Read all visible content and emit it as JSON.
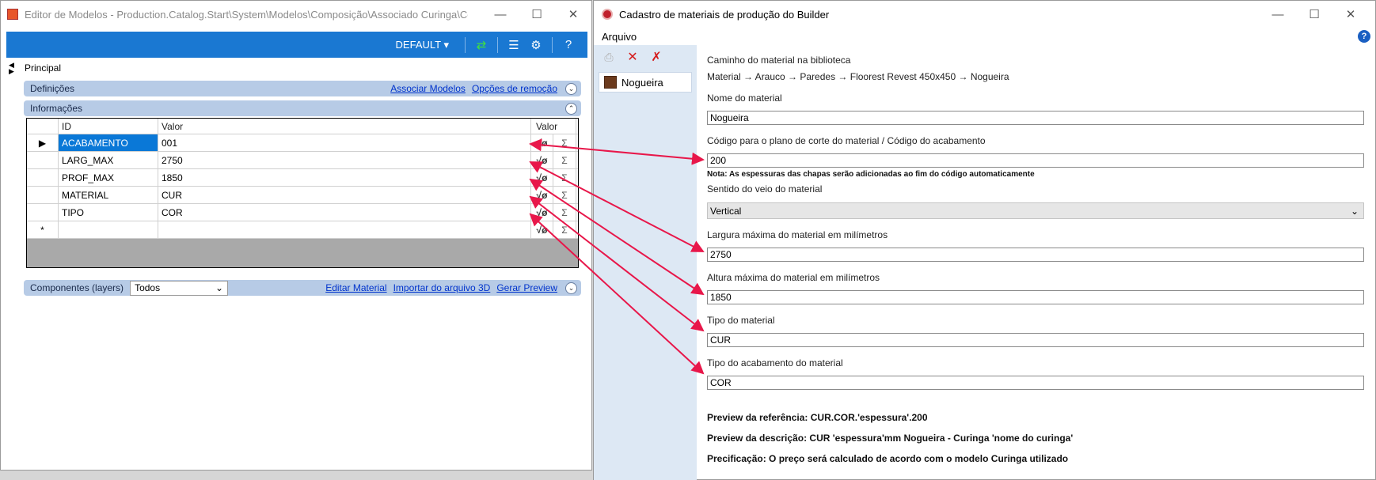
{
  "left_window": {
    "title": "Editor de Modelos - Production.Catalog.Start\\System\\Modelos\\Composição\\Associado Curinga\\Cor",
    "toolbar": {
      "profile": "DEFAULT"
    },
    "principal_label": "Principal",
    "definicoes": {
      "label": "Definições",
      "link_associar": "Associar Modelos",
      "link_opcoes": "Opções de remoção"
    },
    "informacoes": {
      "label": "Informações",
      "headers": {
        "id": "ID",
        "valor": "Valor",
        "valor2": "Valor"
      },
      "rows": [
        {
          "id": "ACABAMENTO",
          "valor": "001"
        },
        {
          "id": "LARG_MAX",
          "valor": "2750"
        },
        {
          "id": "PROF_MAX",
          "valor": "1850"
        },
        {
          "id": "MATERIAL",
          "valor": "CUR"
        },
        {
          "id": "TIPO",
          "valor": "COR"
        }
      ],
      "new_row_marker": "*"
    },
    "componentes": {
      "label": "Componentes (layers)",
      "select_value": "Todos",
      "link_editar": "Editar Material",
      "link_importar": "Importar do arquivo 3D",
      "link_gerar": "Gerar Preview"
    }
  },
  "right_window": {
    "title": "Cadastro de materiais de produção do Builder",
    "menu": {
      "arquivo": "Arquivo"
    },
    "side_item": "Nogueira",
    "form": {
      "caminho_label": "Caminho do material na biblioteca",
      "caminho_value": "Material → Arauco → Paredes → Floorest Revest 450x450 → Nogueira",
      "nome_label": "Nome do material",
      "nome_value": "Nogueira",
      "codigo_label": "Código para o plano de corte do material / Código do acabamento",
      "codigo_value": "200",
      "codigo_note": "Nota: As espessuras das chapas serão adicionadas ao fim do código automaticamente",
      "sentido_label": "Sentido do veio do material",
      "sentido_value": "Vertical",
      "largura_label": "Largura máxima do material em milímetros",
      "largura_value": "2750",
      "altura_label": "Altura máxima do material em milímetros",
      "altura_value": "1850",
      "tipo_label": "Tipo do material",
      "tipo_value": "CUR",
      "acab_label": "Tipo do acabamento do material",
      "acab_value": "COR",
      "preview_ref": "Preview da referência: CUR.COR.'espessura'.200",
      "preview_desc": "Preview da descrição: CUR 'espessura'mm Nogueira - Curinga 'nome do curinga'",
      "precificacao": "Precificação: O preço será calculado de acordo com o modelo Curinga utilizado"
    }
  },
  "colors": {
    "accent_blue": "#1a78d2",
    "arrow_red": "#e8174a",
    "section_bar": "#b7cbe6",
    "selected_cell": "#0a78d7"
  }
}
